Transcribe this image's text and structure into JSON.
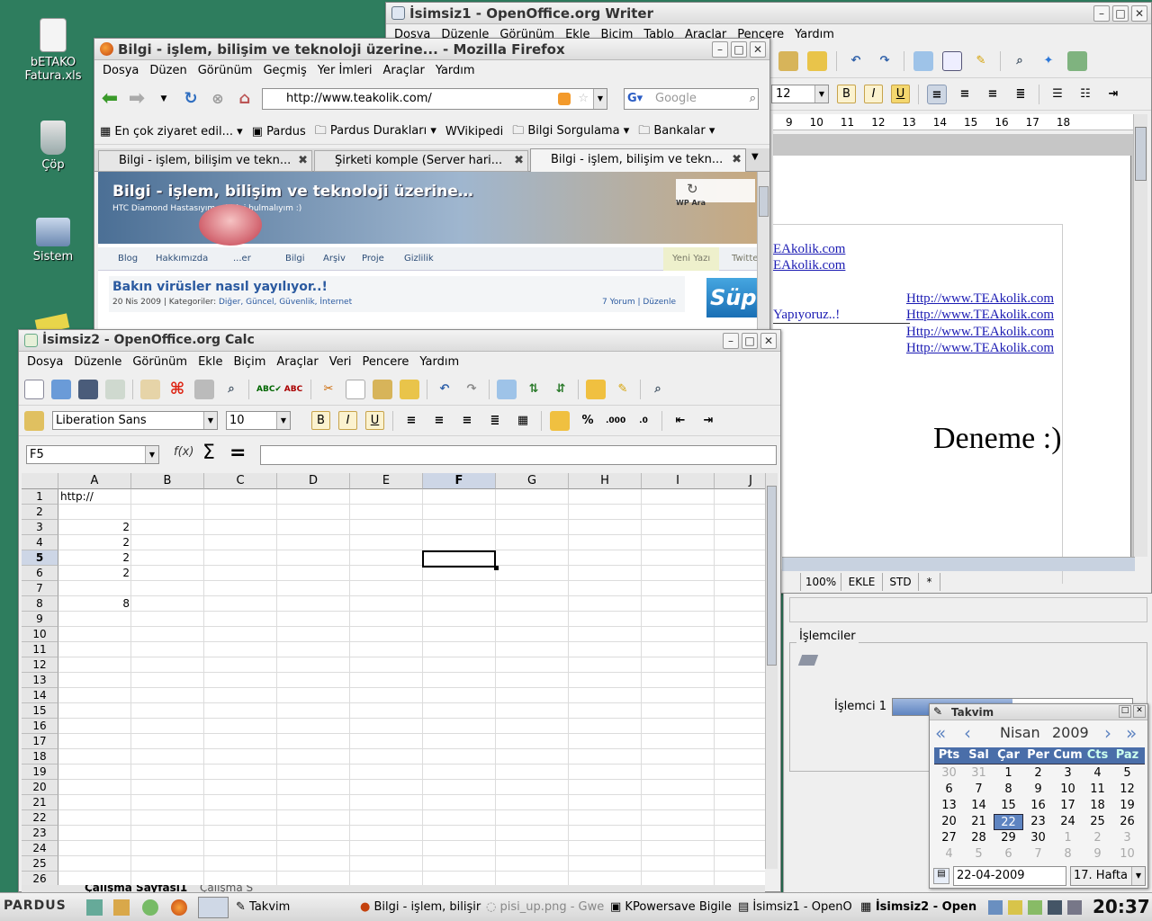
{
  "desktop": {
    "icons": [
      {
        "label": "bETAKO Fatura.xls"
      },
      {
        "label": "Çöp"
      },
      {
        "label": "Sistem"
      }
    ]
  },
  "writer": {
    "title": "İsimsiz1 - OpenOffice.org Writer",
    "menu": [
      "Dosya",
      "Düzenle",
      "Görünüm",
      "Ekle",
      "Biçim",
      "Tablo",
      "Araçlar",
      "Pencere",
      "Yardım"
    ],
    "font_size": "12",
    "ruler": [
      "9",
      "10",
      "11",
      "12",
      "13",
      "14",
      "15",
      "16",
      "17",
      "18"
    ],
    "lines": [
      "EAkolik.com",
      "EAkolik.com"
    ],
    "links": [
      "Http://www.TEAkolik.com",
      "Http://www.TEAkolik.com",
      "Http://www.TEAkolik.com",
      "Http://www.TEAkolik.com"
    ],
    "left_text": "Yapıyoruz..!",
    "big_text": "Deneme :)",
    "status": {
      "zoom": "100%",
      "mode": "EKLE",
      "sel": "STD",
      "mod": "*"
    }
  },
  "firefox": {
    "title": "Bilgi - işlem, bilişim ve teknoloji üzerine... - Mozilla Firefox",
    "menu": [
      "Dosya",
      "Düzen",
      "Görünüm",
      "Geçmiş",
      "Yer İmleri",
      "Araçlar",
      "Yardım"
    ],
    "url": "http://www.teakolik.com/",
    "search_placeholder": "Google",
    "bookmarks": [
      "En çok ziyaret edil...",
      "Pardus",
      "Pardus Durakları",
      "Vikipedi",
      "Bilgi Sorgulama",
      "Bankalar"
    ],
    "tabs": [
      "Bilgi - işlem, bilişim ve tekn...",
      "Şirketi komple (Server hari...",
      "Bilgi - işlem, bilişim ve tekn..."
    ],
    "site": {
      "title": "Bilgi - işlem, bilişim ve teknoloji üzerine…",
      "subtitle": "HTC Diamond Hastasıyım... birini bulmalıyım :)",
      "search_btn": "WP Ara",
      "nav": [
        "Blog",
        "Hakkımızda",
        "...er",
        "Bilgi",
        "Arşiv",
        "Proje",
        "Gizlilik"
      ],
      "nav_right": [
        "Yeni Yazı",
        "Twitte"
      ],
      "post_title": "Bakın virüsler nasıl yayılıyor..!",
      "post_meta": "20 Nis 2009 | Kategoriler:",
      "post_cats": "Diğer, Güncel, Güvenlik, İnternet",
      "post_right": "7 Yorum | Düzenle",
      "side": "Süp"
    }
  },
  "calc": {
    "title": "İsimsiz2 - OpenOffice.org Calc",
    "menu": [
      "Dosya",
      "Düzenle",
      "Görünüm",
      "Ekle",
      "Biçim",
      "Araçlar",
      "Veri",
      "Pencere",
      "Yardım"
    ],
    "font": "Liberation Sans",
    "size": "10",
    "namebox": "F5",
    "columns": [
      "A",
      "B",
      "C",
      "D",
      "E",
      "F",
      "G",
      "H",
      "I",
      "J"
    ],
    "rows": [
      "1",
      "2",
      "3",
      "4",
      "5",
      "6",
      "7",
      "8",
      "9",
      "10",
      "11",
      "12",
      "13",
      "14",
      "15",
      "16",
      "17",
      "18",
      "19",
      "20",
      "21",
      "22",
      "23",
      "24",
      "25",
      "26"
    ],
    "cells": {
      "A1": "http://",
      "A3": "2",
      "A4": "2",
      "A5": "2",
      "A6": "2",
      "A8": "8"
    },
    "sheet_tabs": [
      "Çalışma Sayfası1",
      "Çalışma S"
    ]
  },
  "kpower": {
    "group": "İşlemciler",
    "cpu_label": "İşlemci 1"
  },
  "calendar": {
    "title": "Takvim",
    "month": "Nisan",
    "year": "2009",
    "weekdays": [
      "Pts",
      "Sal",
      "Çar",
      "Per",
      "Cum",
      "Cts",
      "Paz"
    ],
    "weeks": [
      [
        "30",
        "31",
        "1",
        "2",
        "3",
        "4",
        "5"
      ],
      [
        "6",
        "7",
        "8",
        "9",
        "10",
        "11",
        "12"
      ],
      [
        "13",
        "14",
        "15",
        "16",
        "17",
        "18",
        "19"
      ],
      [
        "20",
        "21",
        "22",
        "23",
        "24",
        "25",
        "26"
      ],
      [
        "27",
        "28",
        "29",
        "30",
        "1",
        "2",
        "3"
      ],
      [
        "4",
        "5",
        "6",
        "7",
        "8",
        "9",
        "10"
      ]
    ],
    "date": "22-04-2009",
    "week": "17. Hafta"
  },
  "taskbar": {
    "logo": "PARDUS",
    "tasks": [
      "Takvim",
      "Bilgi - işlem, bilişir",
      "pisi_up.png - Gwe",
      "KPowersave Bigile",
      "İsimsiz1 - OpenO",
      "İsimsiz2 - Open"
    ],
    "clock": "20:37"
  },
  "colors": {
    "desktop": "#2e7d5e",
    "accent": "#4a6ea9",
    "selection": "#5e84c1"
  }
}
